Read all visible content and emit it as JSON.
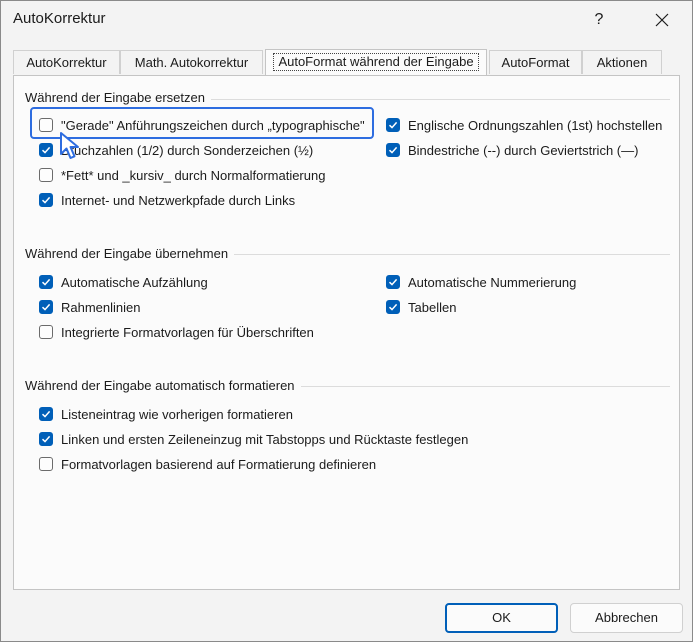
{
  "window": {
    "title": "AutoKorrektur",
    "help_label": "?"
  },
  "tabs": [
    {
      "label": "AutoKorrektur",
      "active": false
    },
    {
      "label": "Math. Autokorrektur",
      "active": false
    },
    {
      "label": "AutoFormat während der Eingabe",
      "active": true
    },
    {
      "label": "AutoFormat",
      "active": false
    },
    {
      "label": "Aktionen",
      "active": false
    }
  ],
  "groups": {
    "replace": {
      "title": "Während der Eingabe ersetzen",
      "items": [
        {
          "label": "\"Gerade\" Anführungszeichen durch „typographische\"",
          "checked": false
        },
        {
          "label": "Englische Ordnungszahlen (1st) hochstellen",
          "checked": true
        },
        {
          "label": "Bruchzahlen (1/2) durch Sonderzeichen (½)",
          "checked": true
        },
        {
          "label": "Bindestriche (--) durch Geviertstrich (—)",
          "checked": true
        },
        {
          "label": "*Fett* und _kursiv_ durch Normalformatierung",
          "checked": false
        },
        {
          "label": "Internet- und Netzwerkpfade durch Links",
          "checked": true
        }
      ]
    },
    "apply": {
      "title": "Während der Eingabe übernehmen",
      "items": [
        {
          "label": "Automatische Aufzählung",
          "checked": true
        },
        {
          "label": "Automatische Nummerierung",
          "checked": true
        },
        {
          "label": "Rahmenlinien",
          "checked": true
        },
        {
          "label": "Tabellen",
          "checked": true
        },
        {
          "label": "Integrierte Formatvorlagen für Überschriften",
          "checked": false
        }
      ]
    },
    "auto_format": {
      "title": "Während der Eingabe automatisch formatieren",
      "items": [
        {
          "label": "Listeneintrag wie vorherigen formatieren",
          "checked": true
        },
        {
          "label": "Linken und ersten Zeileneinzug mit Tabstopps und Rücktaste festlegen",
          "checked": true
        },
        {
          "label": "Formatvorlagen basierend auf Formatierung definieren",
          "checked": false
        }
      ]
    }
  },
  "buttons": {
    "ok": "OK",
    "cancel": "Abbrechen"
  },
  "colors": {
    "accent": "#005fb8",
    "highlight": "#2e6de0"
  }
}
